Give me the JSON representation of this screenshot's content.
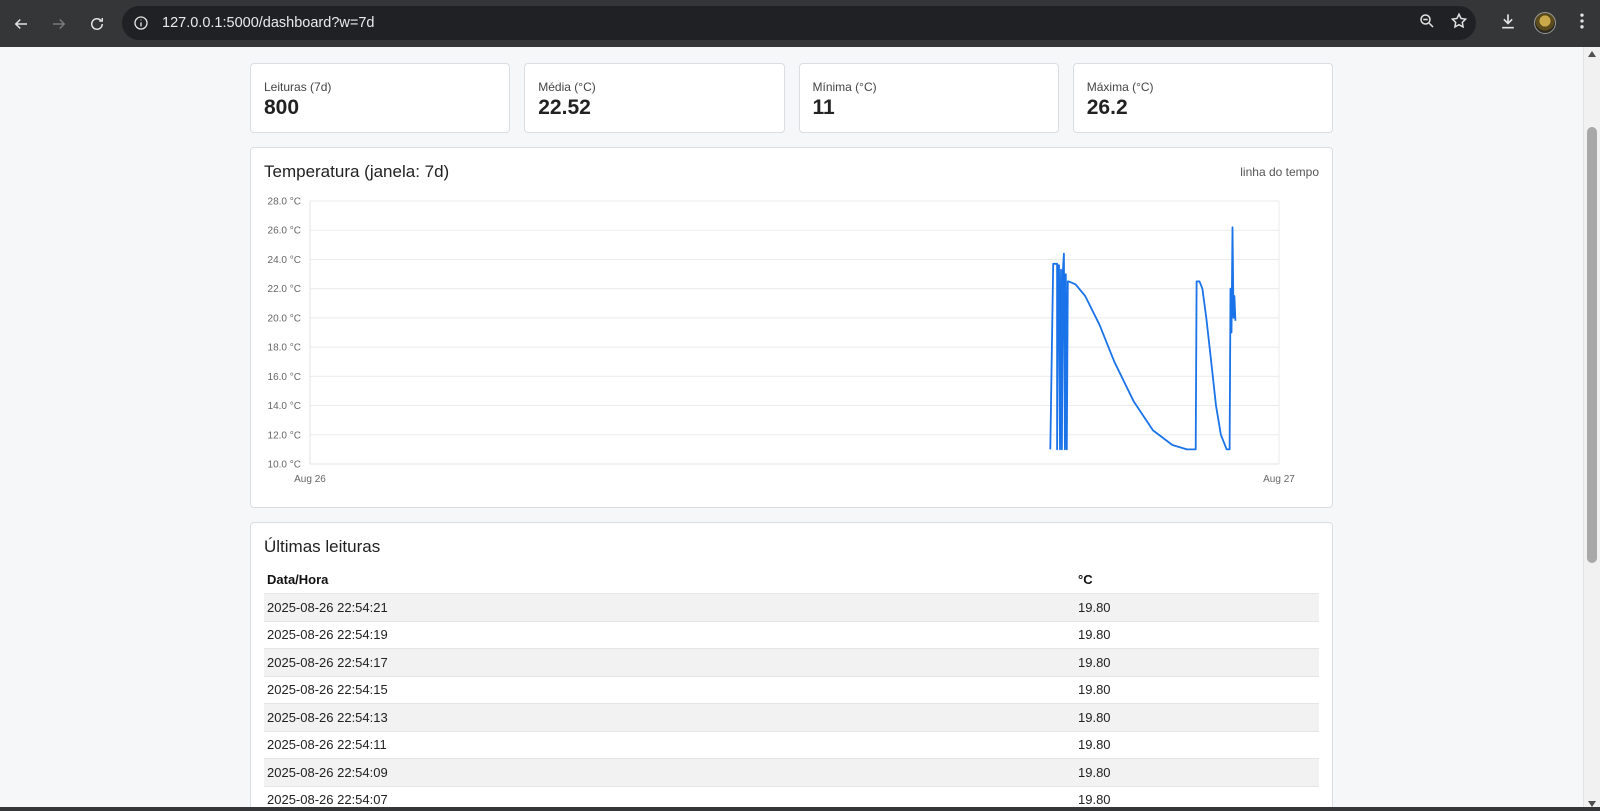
{
  "browser": {
    "url": "127.0.0.1:5000/dashboard?w=7d"
  },
  "stats": [
    {
      "label": "Leituras (7d)",
      "value": "800"
    },
    {
      "label": "Média (°C)",
      "value": "22.52"
    },
    {
      "label": "Mínima (°C)",
      "value": "11"
    },
    {
      "label": "Máxima (°C)",
      "value": "26.2"
    }
  ],
  "chart": {
    "title": "Temperatura (janela: 7d)",
    "hint": "linha do tempo"
  },
  "chart_data": {
    "type": "line",
    "y_ticks": [
      "10.0 °C",
      "12.0 °C",
      "14.0 °C",
      "16.0 °C",
      "18.0 °C",
      "20.0 °C",
      "22.0 °C",
      "24.0 °C",
      "26.0 °C",
      "28.0 °C"
    ],
    "x_ticks": [
      "Aug 26",
      "Aug 27"
    ],
    "ylim": [
      10,
      28
    ],
    "xlim": [
      0,
      1
    ],
    "grid": true,
    "color": "#1a73e8",
    "series": [
      {
        "x": [
          0.764,
          0.767,
          0.768,
          0.771,
          0.771,
          0.772,
          0.773,
          0.774,
          0.775,
          0.776,
          0.777,
          0.778,
          0.779,
          0.78,
          0.781,
          0.782,
          0.783,
          0.79,
          0.8,
          0.815,
          0.83,
          0.85,
          0.87,
          0.89,
          0.905,
          0.914,
          0.915,
          0.918,
          0.921,
          0.925,
          0.93,
          0.935,
          0.94,
          0.946,
          0.949,
          0.95,
          0.951,
          0.952,
          0.953,
          0.954,
          0.955
        ],
        "y": [
          11.0,
          23.7,
          23.7,
          23.7,
          11.0,
          23.6,
          23.6,
          11.0,
          23.3,
          11.0,
          23.2,
          24.4,
          11.0,
          23.0,
          11.0,
          22.5,
          22.5,
          22.3,
          21.5,
          19.5,
          17.0,
          14.3,
          12.3,
          11.3,
          11.0,
          11.0,
          22.5,
          22.5,
          22.0,
          20.0,
          17.0,
          14.0,
          12.0,
          11.0,
          11.0,
          22.0,
          19.0,
          26.2,
          20.0,
          21.5,
          19.8
        ]
      }
    ]
  },
  "table": {
    "title": "Últimas leituras",
    "columns": [
      "Data/Hora",
      "°C"
    ],
    "rows": [
      [
        "2025-08-26 22:54:21",
        "19.80"
      ],
      [
        "2025-08-26 22:54:19",
        "19.80"
      ],
      [
        "2025-08-26 22:54:17",
        "19.80"
      ],
      [
        "2025-08-26 22:54:15",
        "19.80"
      ],
      [
        "2025-08-26 22:54:13",
        "19.80"
      ],
      [
        "2025-08-26 22:54:11",
        "19.80"
      ],
      [
        "2025-08-26 22:54:09",
        "19.80"
      ],
      [
        "2025-08-26 22:54:07",
        "19.80"
      ]
    ]
  }
}
